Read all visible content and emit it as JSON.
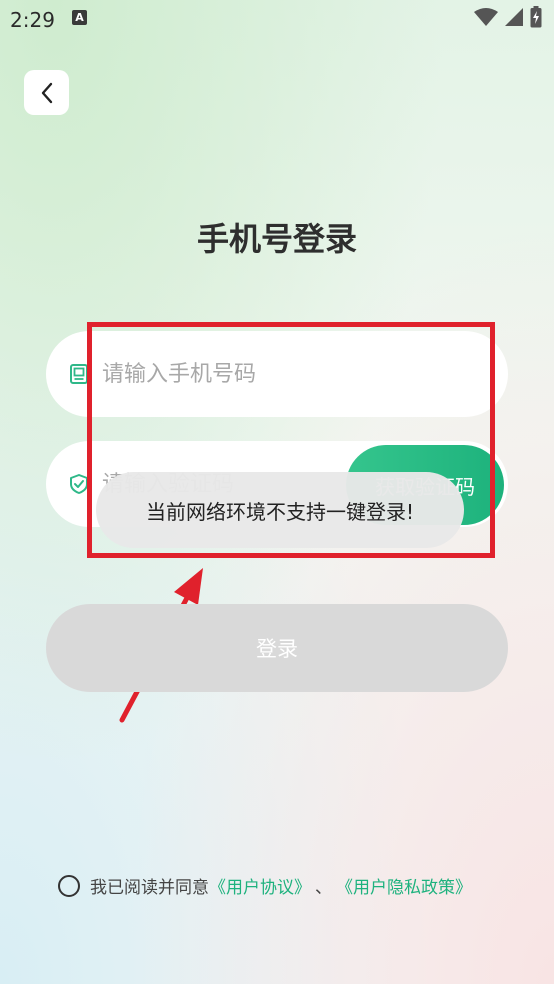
{
  "status_bar": {
    "time": "2:29",
    "notification_icon": "A"
  },
  "page": {
    "title": "手机号登录"
  },
  "phone_field": {
    "placeholder": "请输入手机号码",
    "icon": "phone-icon"
  },
  "code_field": {
    "placeholder": "请输入验证码",
    "icon": "shield-check-icon"
  },
  "get_code_button": {
    "label": "获取验证码"
  },
  "toast": {
    "message": "当前网络环境不支持一键登录!"
  },
  "login_button": {
    "label": "登录"
  },
  "agreement": {
    "prefix": "我已阅读并同意",
    "user_agreement": "《用户协议》",
    "separator": "、",
    "privacy_policy": "《用户隐私政策》"
  },
  "colors": {
    "accent": "#1eb27e",
    "annotation_red": "#e0212c",
    "disabled_button": "#d9d9d9"
  }
}
